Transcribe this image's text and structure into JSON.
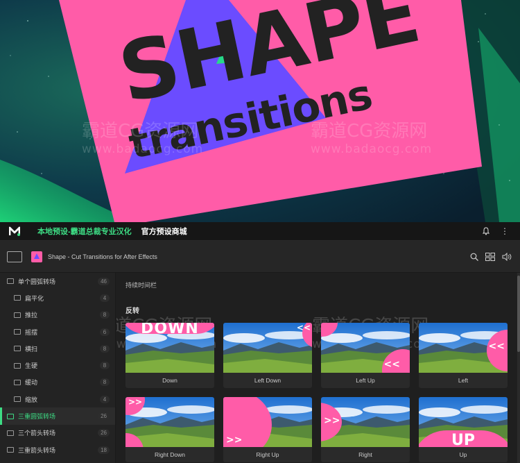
{
  "hero": {
    "title": "SHAPE",
    "subtitle": "transitions",
    "watermark_cn": "霸道CG资源网",
    "watermark_url": "www.badaocg.com"
  },
  "nav": {
    "tabs": [
      {
        "label": "本地预设-霸道总裁专业汉化",
        "active": true
      },
      {
        "label": "官方预设商城",
        "active": false
      }
    ],
    "kebab": "⋮"
  },
  "breadcrumb": {
    "pack_name": "Shape - Cut Transitions for After Effects"
  },
  "sidebar": {
    "items": [
      {
        "label": "单个圆弧转场",
        "count": "46",
        "level": 0,
        "active": false
      },
      {
        "label": "扁平化",
        "count": "4",
        "level": 1,
        "active": false
      },
      {
        "label": "推拉",
        "count": "8",
        "level": 1,
        "active": false
      },
      {
        "label": "摇摆",
        "count": "6",
        "level": 1,
        "active": false
      },
      {
        "label": "横扫",
        "count": "8",
        "level": 1,
        "active": false
      },
      {
        "label": "生硬",
        "count": "8",
        "level": 1,
        "active": false
      },
      {
        "label": "缓动",
        "count": "8",
        "level": 1,
        "active": false
      },
      {
        "label": "缩放",
        "count": "4",
        "level": 1,
        "active": false
      },
      {
        "label": "三重圆弧转场",
        "count": "26",
        "level": 0,
        "active": true
      },
      {
        "label": "三个箭头转场",
        "count": "26",
        "level": 0,
        "active": false
      },
      {
        "label": "三重箭头转场",
        "count": "18",
        "level": 0,
        "active": false
      }
    ]
  },
  "main": {
    "timeline_label": "持续时间栏",
    "section_title": "反转",
    "cards": [
      {
        "caption": "Down",
        "overlay": "DOWN"
      },
      {
        "caption": "Left Down",
        "overlay": "<<"
      },
      {
        "caption": "Left Up",
        "overlay": "<<"
      },
      {
        "caption": "Left",
        "overlay": "<<"
      },
      {
        "caption": "Right Down",
        "overlay": ">>"
      },
      {
        "caption": "Right Up",
        "overlay": ">>"
      },
      {
        "caption": "Right",
        "overlay": ">>"
      },
      {
        "caption": "Up",
        "overlay": "UP"
      }
    ]
  },
  "colors": {
    "accent": "#3ddc84",
    "pink": "#ff5ca8",
    "purple": "#6b4cff",
    "dark_bg": "#1e1e1e"
  }
}
